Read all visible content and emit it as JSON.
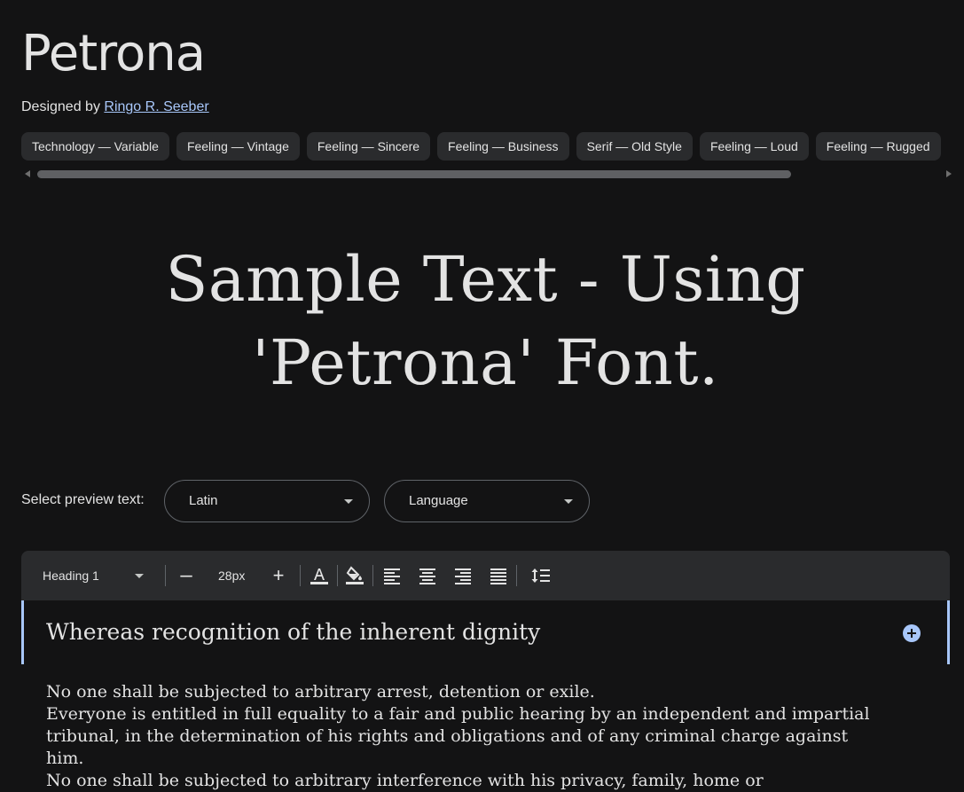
{
  "font": {
    "name": "Petrona",
    "designed_by_prefix": "Designed by ",
    "designer": "Ringo R. Seeber"
  },
  "tags": [
    "Technology — Variable",
    "Feeling — Vintage",
    "Feeling — Sincere",
    "Feeling — Business",
    "Serif — Old Style",
    "Feeling — Loud",
    "Feeling — Rugged"
  ],
  "sample": {
    "text": "Sample Text - Using 'Petrona' Font."
  },
  "preview": {
    "label": "Select preview text:",
    "script_value": "Latin",
    "language_value": "Language"
  },
  "toolbar": {
    "style": "Heading 1",
    "minus": "–",
    "size": "28px",
    "plus": "+",
    "icons": [
      "text-color-icon",
      "highlight-color-icon",
      "align-left-icon",
      "align-center-icon",
      "align-right-icon",
      "align-justify-icon",
      "line-spacing-icon"
    ]
  },
  "editor": {
    "heading": "Whereas recognition of the inherent dignity",
    "paragraphs": [
      "No one shall be subjected to arbitrary arrest, detention or exile.",
      "Everyone is entitled in full equality to a fair and public hearing by an independent and impartial tribunal, in the determination of his rights and obligations and of any criminal charge against him.",
      "No one shall be subjected to arbitrary interference with his privacy, family, home or"
    ]
  },
  "colors": {
    "background": "#131314",
    "chip": "#2a2b2d",
    "accent": "#a8c7fa",
    "text": "#e3e3e3"
  }
}
